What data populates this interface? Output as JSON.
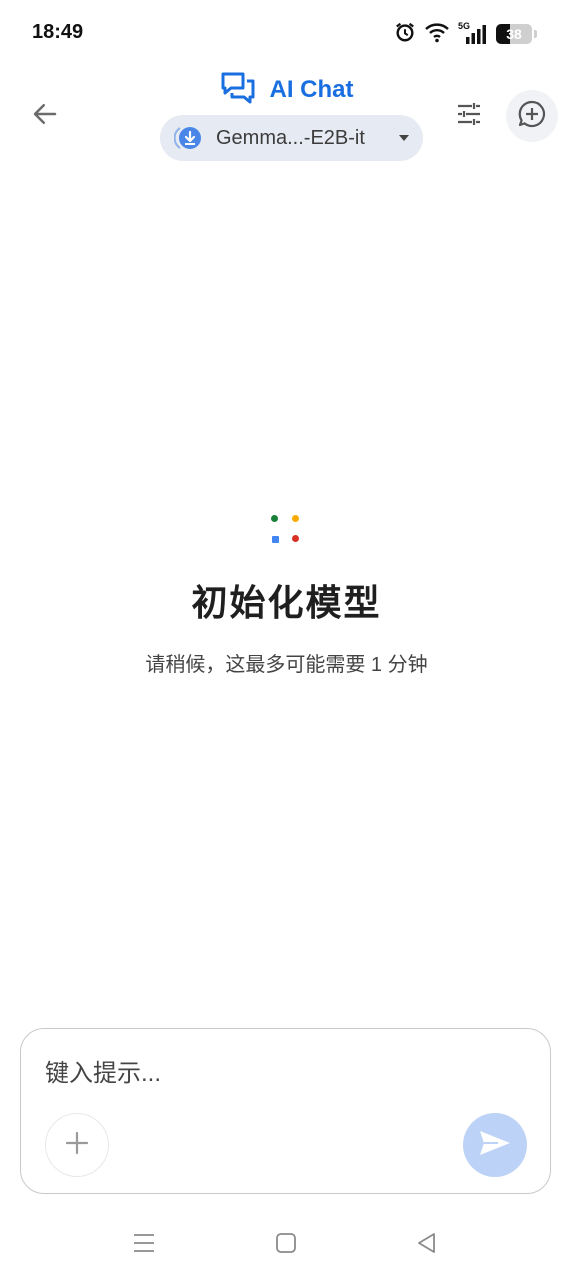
{
  "status_bar": {
    "time": "18:49",
    "network": "5G",
    "battery": "38",
    "icons": [
      "alarm-icon",
      "wifi-icon",
      "signal-icon",
      "battery-icon"
    ]
  },
  "header": {
    "title": "AI Chat",
    "model_name": "Gemma...-E2B-it",
    "icons": [
      "back-arrow-icon",
      "chat-bubbles-icon",
      "download-icon",
      "caret-down-icon",
      "tune-icon",
      "new-chat-icon"
    ]
  },
  "main": {
    "title": "初始化模型",
    "subtitle": "请稍候，这最多可能需要 1 分钟",
    "loading_dot_colors": [
      "#188038",
      "#f9ab00",
      "#4285f4",
      "#d93025"
    ]
  },
  "composer": {
    "placeholder": "键入提示...",
    "icons": [
      "plus-icon",
      "send-icon"
    ]
  },
  "nav": {
    "icons": [
      "menu-icon",
      "home-icon",
      "back-triangle-icon"
    ]
  },
  "colors": {
    "accent": "#1a6fe0",
    "chip_bg": "#e6eaf2",
    "send_bg": "#bcd2f7"
  }
}
